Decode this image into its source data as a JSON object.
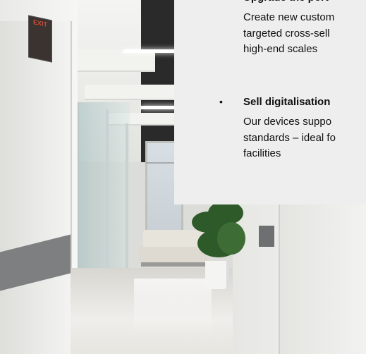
{
  "benefits": {
    "items": [
      {
        "title": "Upgrade the port",
        "text": "Create new custom\ntargeted cross-sell\nhigh-end scales"
      },
      {
        "title": "Sell digitalisation",
        "text": "Our devices suppo\nstandards – ideal fo\nfacilities"
      }
    ]
  },
  "background": {
    "exit_sign": "EXIT"
  }
}
